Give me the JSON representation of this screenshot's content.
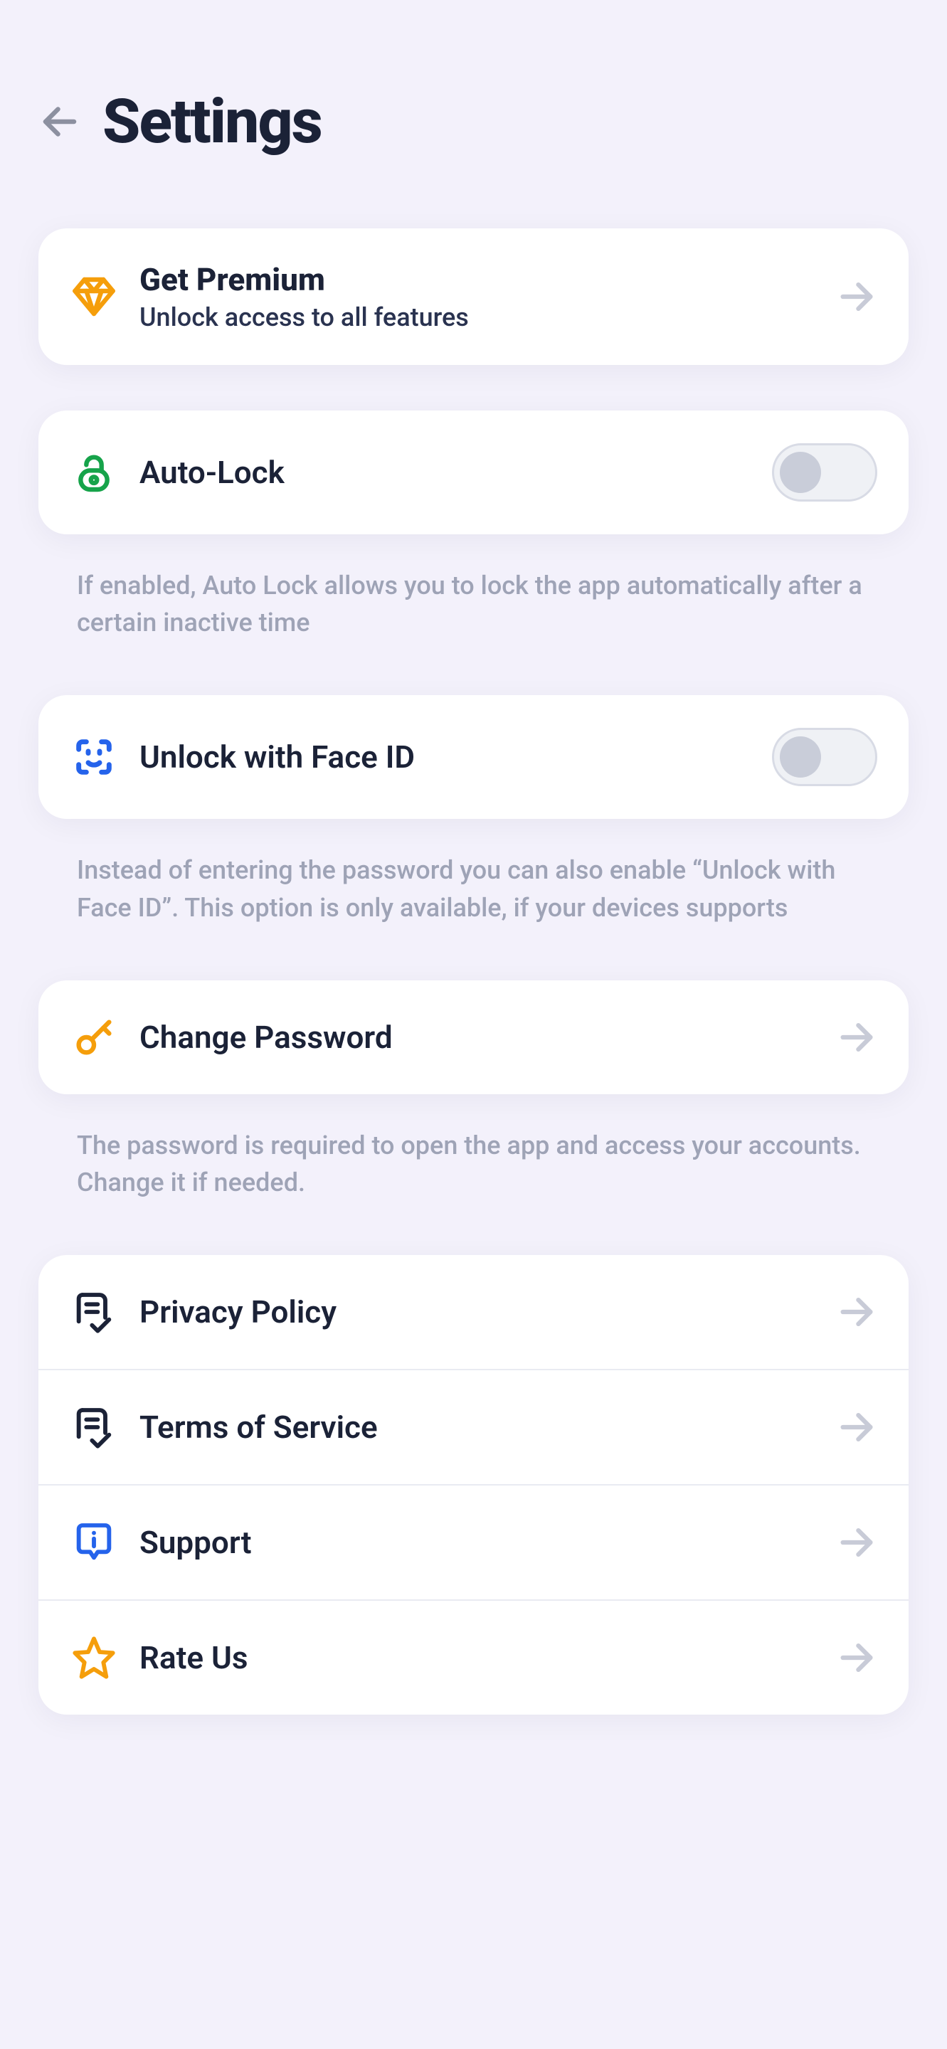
{
  "header": {
    "title": "Settings"
  },
  "premium": {
    "title": "Get Premium",
    "subtitle": "Unlock access to all features"
  },
  "autolock": {
    "title": "Auto-Lock",
    "help": "If enabled, Auto Lock allows you to lock the app automatically after a certain inactive time",
    "enabled": false
  },
  "faceid": {
    "title": "Unlock with Face ID",
    "help": "Instead of entering the password you can also enable “Unlock with Face ID”. This option is only available, if your devices supports",
    "enabled": false
  },
  "changepwd": {
    "title": "Change Password",
    "help": "The password is required to open the app and access your accounts. Change it if needed."
  },
  "links": {
    "privacy": {
      "label": "Privacy Policy"
    },
    "terms": {
      "label": "Terms of Service"
    },
    "support": {
      "label": "Support"
    },
    "rate": {
      "label": "Rate Us"
    }
  },
  "icons": {
    "back": "arrow-left",
    "premium": "diamond",
    "lock": "lock",
    "faceid": "face-id",
    "key": "key",
    "doc": "document-check",
    "support": "chat-info",
    "star": "star",
    "chevron": "chevron-right"
  },
  "colors": {
    "accent_orange": "#f59e0b",
    "accent_green": "#22c55e",
    "accent_blue": "#2563eb",
    "accent_blue_lt": "#3b82f6",
    "text": "#1b2237",
    "muted": "#9ea3b6",
    "bg": "#f3f1fb",
    "card": "#ffffff"
  }
}
